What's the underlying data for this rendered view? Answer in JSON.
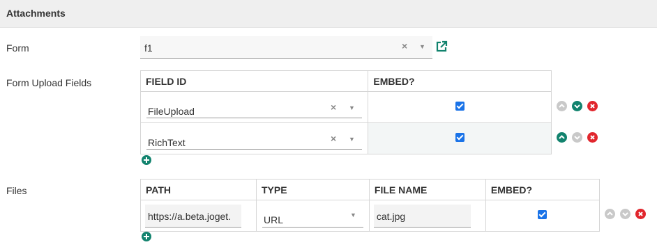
{
  "section": {
    "title": "Attachments"
  },
  "form": {
    "label": "Form",
    "selected": "f1"
  },
  "upload_fields": {
    "label": "Form Upload Fields",
    "columns": [
      "FIELD ID",
      "EMBED?"
    ],
    "rows": [
      {
        "field_id": "FileUpload",
        "embed": true
      },
      {
        "field_id": "RichText",
        "embed": true
      }
    ]
  },
  "files": {
    "label": "Files",
    "columns": [
      "PATH",
      "TYPE",
      "FILE NAME",
      "EMBED?"
    ],
    "rows": [
      {
        "path": "https://a.beta.joget.",
        "type": "URL",
        "file_name": "cat.jpg",
        "embed": true
      }
    ]
  },
  "icons": {
    "clear": "×",
    "caret": "▼",
    "external_link": "external-link-icon",
    "move_up": "chevron-up-icon",
    "move_down": "chevron-down-icon",
    "delete": "delete-icon",
    "add": "add-icon"
  },
  "colors": {
    "accent_green": "#12836e",
    "delete_red": "#e1262d",
    "checkbox_blue": "#1a73e8",
    "header_bg": "#efefef"
  }
}
